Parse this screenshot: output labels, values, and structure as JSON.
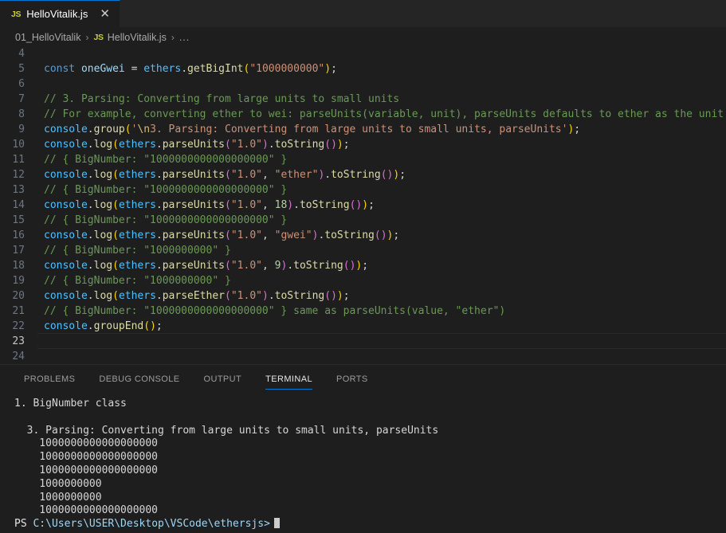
{
  "tab": {
    "icon": "js-file-icon",
    "badge": "JS",
    "label": "HelloVitalik.js",
    "close": "✕"
  },
  "breadcrumb": {
    "folder": "01_HelloVitalik",
    "sep1": "›",
    "badge": "JS",
    "file": "HelloVitalik.js",
    "sep2": "›",
    "dots": "..."
  },
  "editor": {
    "lines": [
      {
        "n": "4",
        "tokens": []
      },
      {
        "n": "5",
        "tokens": [
          {
            "c": "t-keyword",
            "t": "const"
          },
          {
            "c": "t-plain",
            "t": " "
          },
          {
            "c": "t-var",
            "t": "oneGwei"
          },
          {
            "c": "t-plain",
            "t": " "
          },
          {
            "c": "t-op",
            "t": "="
          },
          {
            "c": "t-plain",
            "t": " "
          },
          {
            "c": "t-obj",
            "t": "ethers"
          },
          {
            "c": "t-plain",
            "t": "."
          },
          {
            "c": "t-func",
            "t": "getBigInt"
          },
          {
            "c": "t-p1",
            "t": "("
          },
          {
            "c": "t-string",
            "t": "\"1000000000\""
          },
          {
            "c": "t-p1",
            "t": ")"
          },
          {
            "c": "t-plain",
            "t": ";"
          }
        ]
      },
      {
        "n": "6",
        "tokens": []
      },
      {
        "n": "7",
        "tokens": [
          {
            "c": "t-comment",
            "t": "// 3. Parsing: Converting from large units to small units"
          }
        ]
      },
      {
        "n": "8",
        "tokens": [
          {
            "c": "t-comment",
            "t": "// For example, converting ether to wei: parseUnits(variable, unit), parseUnits defaults to ether as the unit"
          }
        ]
      },
      {
        "n": "9",
        "tokens": [
          {
            "c": "t-obj",
            "t": "console"
          },
          {
            "c": "t-plain",
            "t": "."
          },
          {
            "c": "t-func",
            "t": "group"
          },
          {
            "c": "t-p1",
            "t": "("
          },
          {
            "c": "t-string",
            "t": "'"
          },
          {
            "c": "t-esc",
            "t": "\\n"
          },
          {
            "c": "t-string",
            "t": "3. Parsing: Converting from large units to small units, parseUnits'"
          },
          {
            "c": "t-p1",
            "t": ")"
          },
          {
            "c": "t-plain",
            "t": ";"
          }
        ]
      },
      {
        "n": "10",
        "tokens": [
          {
            "c": "t-obj",
            "t": "console"
          },
          {
            "c": "t-plain",
            "t": "."
          },
          {
            "c": "t-func",
            "t": "log"
          },
          {
            "c": "t-p1",
            "t": "("
          },
          {
            "c": "t-obj",
            "t": "ethers"
          },
          {
            "c": "t-plain",
            "t": "."
          },
          {
            "c": "t-func",
            "t": "parseUnits"
          },
          {
            "c": "t-p2",
            "t": "("
          },
          {
            "c": "t-string",
            "t": "\"1.0\""
          },
          {
            "c": "t-p2",
            "t": ")"
          },
          {
            "c": "t-plain",
            "t": "."
          },
          {
            "c": "t-func",
            "t": "toString"
          },
          {
            "c": "t-p2",
            "t": "()"
          },
          {
            "c": "t-p1",
            "t": ")"
          },
          {
            "c": "t-plain",
            "t": ";"
          }
        ]
      },
      {
        "n": "11",
        "tokens": [
          {
            "c": "t-comment",
            "t": "// { BigNumber: \"1000000000000000000\" }"
          }
        ]
      },
      {
        "n": "12",
        "tokens": [
          {
            "c": "t-obj",
            "t": "console"
          },
          {
            "c": "t-plain",
            "t": "."
          },
          {
            "c": "t-func",
            "t": "log"
          },
          {
            "c": "t-p1",
            "t": "("
          },
          {
            "c": "t-obj",
            "t": "ethers"
          },
          {
            "c": "t-plain",
            "t": "."
          },
          {
            "c": "t-func",
            "t": "parseUnits"
          },
          {
            "c": "t-p2",
            "t": "("
          },
          {
            "c": "t-string",
            "t": "\"1.0\""
          },
          {
            "c": "t-plain",
            "t": ", "
          },
          {
            "c": "t-string",
            "t": "\"ether\""
          },
          {
            "c": "t-p2",
            "t": ")"
          },
          {
            "c": "t-plain",
            "t": "."
          },
          {
            "c": "t-func",
            "t": "toString"
          },
          {
            "c": "t-p2",
            "t": "()"
          },
          {
            "c": "t-p1",
            "t": ")"
          },
          {
            "c": "t-plain",
            "t": ";"
          }
        ]
      },
      {
        "n": "13",
        "tokens": [
          {
            "c": "t-comment",
            "t": "// { BigNumber: \"1000000000000000000\" }"
          }
        ]
      },
      {
        "n": "14",
        "tokens": [
          {
            "c": "t-obj",
            "t": "console"
          },
          {
            "c": "t-plain",
            "t": "."
          },
          {
            "c": "t-func",
            "t": "log"
          },
          {
            "c": "t-p1",
            "t": "("
          },
          {
            "c": "t-obj",
            "t": "ethers"
          },
          {
            "c": "t-plain",
            "t": "."
          },
          {
            "c": "t-func",
            "t": "parseUnits"
          },
          {
            "c": "t-p2",
            "t": "("
          },
          {
            "c": "t-string",
            "t": "\"1.0\""
          },
          {
            "c": "t-plain",
            "t": ", "
          },
          {
            "c": "t-number",
            "t": "18"
          },
          {
            "c": "t-p2",
            "t": ")"
          },
          {
            "c": "t-plain",
            "t": "."
          },
          {
            "c": "t-func",
            "t": "toString"
          },
          {
            "c": "t-p2",
            "t": "()"
          },
          {
            "c": "t-p1",
            "t": ")"
          },
          {
            "c": "t-plain",
            "t": ";"
          }
        ]
      },
      {
        "n": "15",
        "tokens": [
          {
            "c": "t-comment",
            "t": "// { BigNumber: \"1000000000000000000\" }"
          }
        ]
      },
      {
        "n": "16",
        "tokens": [
          {
            "c": "t-obj",
            "t": "console"
          },
          {
            "c": "t-plain",
            "t": "."
          },
          {
            "c": "t-func",
            "t": "log"
          },
          {
            "c": "t-p1",
            "t": "("
          },
          {
            "c": "t-obj",
            "t": "ethers"
          },
          {
            "c": "t-plain",
            "t": "."
          },
          {
            "c": "t-func",
            "t": "parseUnits"
          },
          {
            "c": "t-p2",
            "t": "("
          },
          {
            "c": "t-string",
            "t": "\"1.0\""
          },
          {
            "c": "t-plain",
            "t": ", "
          },
          {
            "c": "t-string",
            "t": "\"gwei\""
          },
          {
            "c": "t-p2",
            "t": ")"
          },
          {
            "c": "t-plain",
            "t": "."
          },
          {
            "c": "t-func",
            "t": "toString"
          },
          {
            "c": "t-p2",
            "t": "()"
          },
          {
            "c": "t-p1",
            "t": ")"
          },
          {
            "c": "t-plain",
            "t": ";"
          }
        ]
      },
      {
        "n": "17",
        "tokens": [
          {
            "c": "t-comment",
            "t": "// { BigNumber: \"1000000000\" }"
          }
        ]
      },
      {
        "n": "18",
        "tokens": [
          {
            "c": "t-obj",
            "t": "console"
          },
          {
            "c": "t-plain",
            "t": "."
          },
          {
            "c": "t-func",
            "t": "log"
          },
          {
            "c": "t-p1",
            "t": "("
          },
          {
            "c": "t-obj",
            "t": "ethers"
          },
          {
            "c": "t-plain",
            "t": "."
          },
          {
            "c": "t-func",
            "t": "parseUnits"
          },
          {
            "c": "t-p2",
            "t": "("
          },
          {
            "c": "t-string",
            "t": "\"1.0\""
          },
          {
            "c": "t-plain",
            "t": ", "
          },
          {
            "c": "t-number",
            "t": "9"
          },
          {
            "c": "t-p2",
            "t": ")"
          },
          {
            "c": "t-plain",
            "t": "."
          },
          {
            "c": "t-func",
            "t": "toString"
          },
          {
            "c": "t-p2",
            "t": "()"
          },
          {
            "c": "t-p1",
            "t": ")"
          },
          {
            "c": "t-plain",
            "t": ";"
          }
        ]
      },
      {
        "n": "19",
        "tokens": [
          {
            "c": "t-comment",
            "t": "// { BigNumber: \"1000000000\" }"
          }
        ]
      },
      {
        "n": "20",
        "tokens": [
          {
            "c": "t-obj",
            "t": "console"
          },
          {
            "c": "t-plain",
            "t": "."
          },
          {
            "c": "t-func",
            "t": "log"
          },
          {
            "c": "t-p1",
            "t": "("
          },
          {
            "c": "t-obj",
            "t": "ethers"
          },
          {
            "c": "t-plain",
            "t": "."
          },
          {
            "c": "t-func",
            "t": "parseEther"
          },
          {
            "c": "t-p2",
            "t": "("
          },
          {
            "c": "t-string",
            "t": "\"1.0\""
          },
          {
            "c": "t-p2",
            "t": ")"
          },
          {
            "c": "t-plain",
            "t": "."
          },
          {
            "c": "t-func",
            "t": "toString"
          },
          {
            "c": "t-p2",
            "t": "()"
          },
          {
            "c": "t-p1",
            "t": ")"
          },
          {
            "c": "t-plain",
            "t": ";"
          }
        ]
      },
      {
        "n": "21",
        "tokens": [
          {
            "c": "t-comment",
            "t": "// { BigNumber: \"1000000000000000000\" } same as parseUnits(value, \"ether\")"
          }
        ]
      },
      {
        "n": "22",
        "tokens": [
          {
            "c": "t-obj",
            "t": "console"
          },
          {
            "c": "t-plain",
            "t": "."
          },
          {
            "c": "t-func",
            "t": "groupEnd"
          },
          {
            "c": "t-p1",
            "t": "()"
          },
          {
            "c": "t-plain",
            "t": ";"
          }
        ]
      },
      {
        "n": "23",
        "tokens": [],
        "active": true
      },
      {
        "n": "24",
        "tokens": []
      }
    ]
  },
  "panel": {
    "tabs": [
      {
        "label": "PROBLEMS",
        "active": false
      },
      {
        "label": "DEBUG CONSOLE",
        "active": false
      },
      {
        "label": "OUTPUT",
        "active": false
      },
      {
        "label": "TERMINAL",
        "active": true
      },
      {
        "label": "PORTS",
        "active": false
      }
    ],
    "terminal": {
      "lines": [
        {
          "type": "out",
          "text": "1. BigNumber class"
        },
        {
          "type": "blank",
          "text": ""
        },
        {
          "type": "out",
          "text": "  3. Parsing: Converting from large units to small units, parseUnits"
        },
        {
          "type": "out",
          "text": "    1000000000000000000"
        },
        {
          "type": "out",
          "text": "    1000000000000000000"
        },
        {
          "type": "out",
          "text": "    1000000000000000000"
        },
        {
          "type": "out",
          "text": "    1000000000"
        },
        {
          "type": "out",
          "text": "    1000000000"
        },
        {
          "type": "out",
          "text": "    1000000000000000000"
        }
      ],
      "prompt_prefix": "PS ",
      "prompt_path": "C:\\Users\\USER\\Desktop\\VSCode\\ethersjs>"
    }
  },
  "colors": {
    "accent": "#0078d4",
    "editor_bg": "#1e1e1e",
    "tabbar_bg": "#252526",
    "comment": "#6a9955",
    "string": "#ce9178",
    "keyword": "#569cd6"
  }
}
